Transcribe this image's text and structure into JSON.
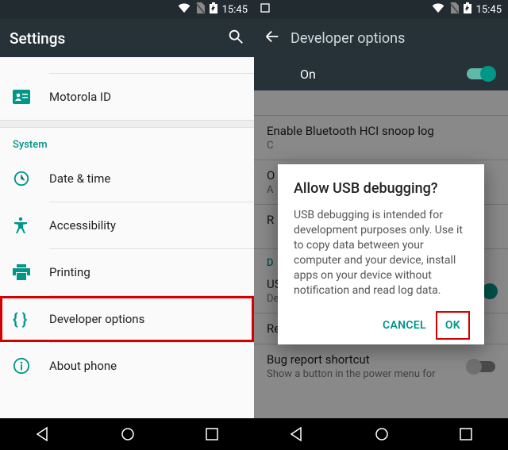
{
  "status": {
    "time": "15:45"
  },
  "left": {
    "title": "Settings",
    "items": {
      "motorola": "Motorola ID",
      "system_header": "System",
      "date_time": "Date & time",
      "accessibility": "Accessibility",
      "printing": "Printing",
      "developer": "Developer options",
      "about": "About phone"
    }
  },
  "right": {
    "title": "Developer options",
    "toggle_label": "On",
    "bg": {
      "bt_log": {
        "t": "Enable Bluetooth HCI snoop log",
        "s": "C"
      },
      "oem": {
        "t": "O",
        "s": "A"
      },
      "reboot": {
        "t": "R",
        "s": ""
      },
      "debug_header": "D",
      "usb": {
        "t": "USB debugging",
        "s": "Debug mode when USB is connected"
      },
      "revoke": {
        "t": "Revoke USB debugging authorisations"
      },
      "bug": {
        "t": "Bug report shortcut",
        "s": "Show a button in the power menu for"
      }
    },
    "dialog": {
      "title": "Allow USB debugging?",
      "body": "USB debugging is intended for development purposes only. Use it to copy data between your computer and your device, install apps on your device without notification and read log data.",
      "cancel": "CANCEL",
      "ok": "OK"
    }
  }
}
